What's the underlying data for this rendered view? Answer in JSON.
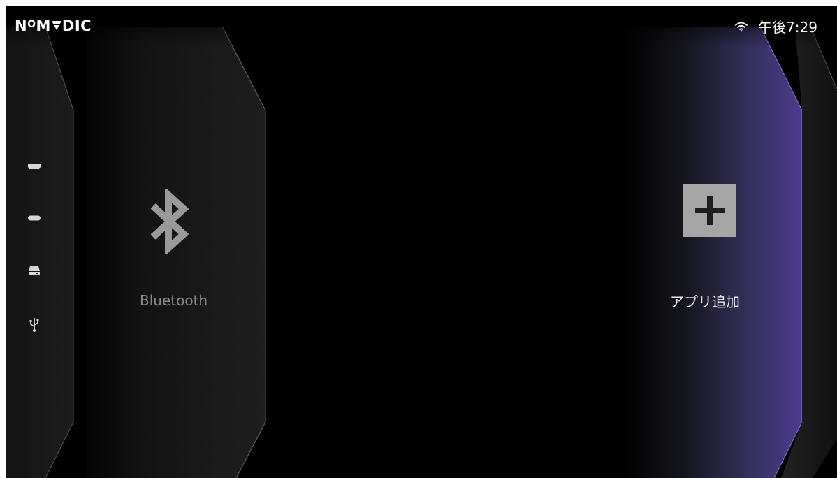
{
  "brand": {
    "logo_text_1": "N",
    "logo_text_2": "O",
    "logo_text_3": "M",
    "logo_text_4": "DIC"
  },
  "status_bar": {
    "wifi_icon": "wifi-icon",
    "time": "午後7:29"
  },
  "input_sources": [
    {
      "icon": "hdmi-icon"
    },
    {
      "icon": "usb-c-icon"
    },
    {
      "icon": "storage-drive-icon"
    },
    {
      "icon": "usb-icon"
    }
  ],
  "cards": {
    "bluetooth": {
      "icon": "bluetooth-icon",
      "label": "Bluetooth"
    },
    "add_app": {
      "icon": "plus-icon",
      "label": "アプリ追加"
    }
  },
  "colors": {
    "background": "#000000",
    "label_dim": "#8a8a8a",
    "label_bright": "#f2f2f2",
    "accent_purple": "#4a3a8a",
    "tile_gray": "#a6a6a6"
  }
}
